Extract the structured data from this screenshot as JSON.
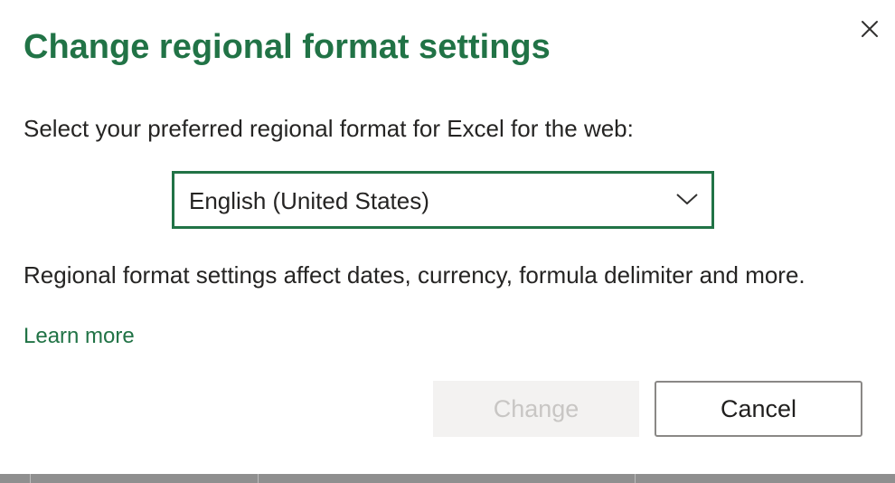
{
  "dialog": {
    "title": "Change regional format settings",
    "prompt": "Select your preferred regional format for Excel for the web:",
    "selected_format": "English (United States)",
    "info": "Regional format settings affect dates, currency, formula delimiter and more.",
    "learn_more": "Learn more",
    "buttons": {
      "change_label": "Change",
      "cancel_label": "Cancel"
    },
    "icons": {
      "close": "close-icon",
      "dropdown": "chevron-down-icon"
    },
    "colors": {
      "accent": "#217346",
      "text": "#252423",
      "disabled_bg": "#f3f2f1",
      "disabled_text": "#c8c6c4"
    }
  }
}
